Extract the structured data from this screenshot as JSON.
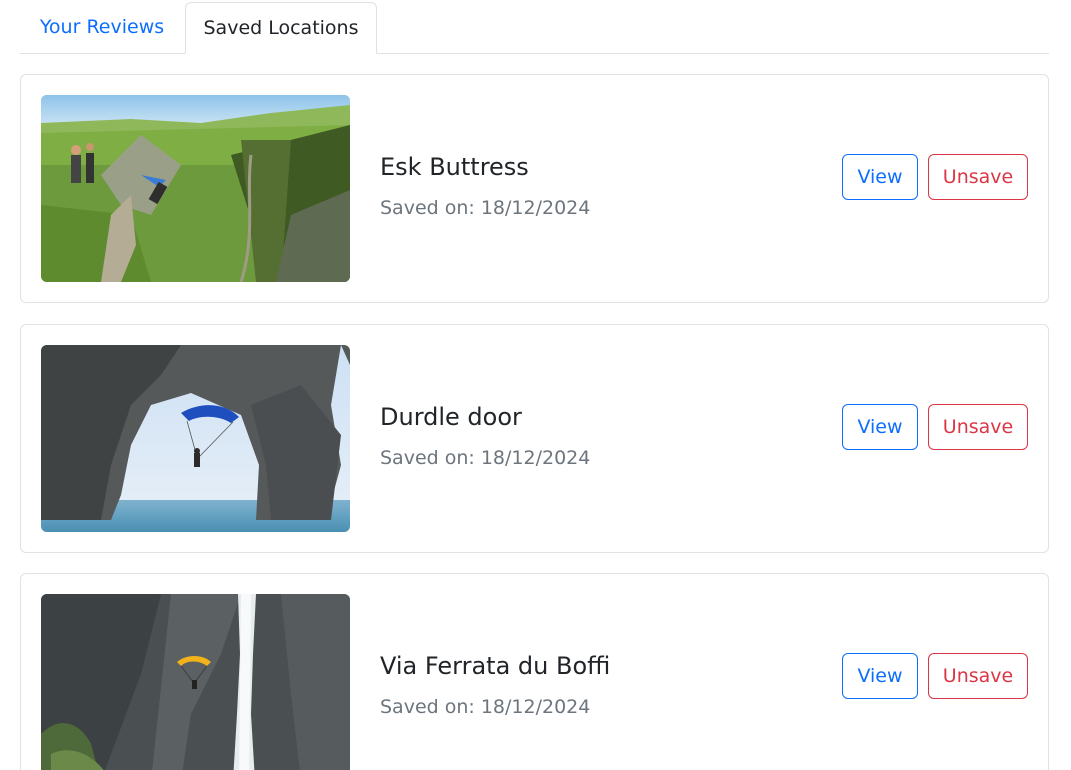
{
  "tabs": [
    {
      "label": "Your Reviews",
      "active": false
    },
    {
      "label": "Saved Locations",
      "active": true
    }
  ],
  "colors": {
    "link_blue": "#0d6efd",
    "danger_red": "#dc3545",
    "muted_text": "#6c757d",
    "border": "#dee2e6"
  },
  "saved_locations": [
    {
      "title": "Esk Buttress",
      "saved_on": "Saved on: 18/12/2024",
      "image_icon": "green-valley-cliff-photo",
      "view_label": "View",
      "unsave_label": "Unsave"
    },
    {
      "title": "Durdle door",
      "saved_on": "Saved on: 18/12/2024",
      "image_icon": "sea-arch-parachute-photo",
      "view_label": "View",
      "unsave_label": "Unsave"
    },
    {
      "title": "Via Ferrata du Boffi",
      "saved_on": "Saved on: 18/12/2024",
      "image_icon": "waterfall-cliff-parachute-photo",
      "view_label": "View",
      "unsave_label": "Unsave"
    }
  ]
}
